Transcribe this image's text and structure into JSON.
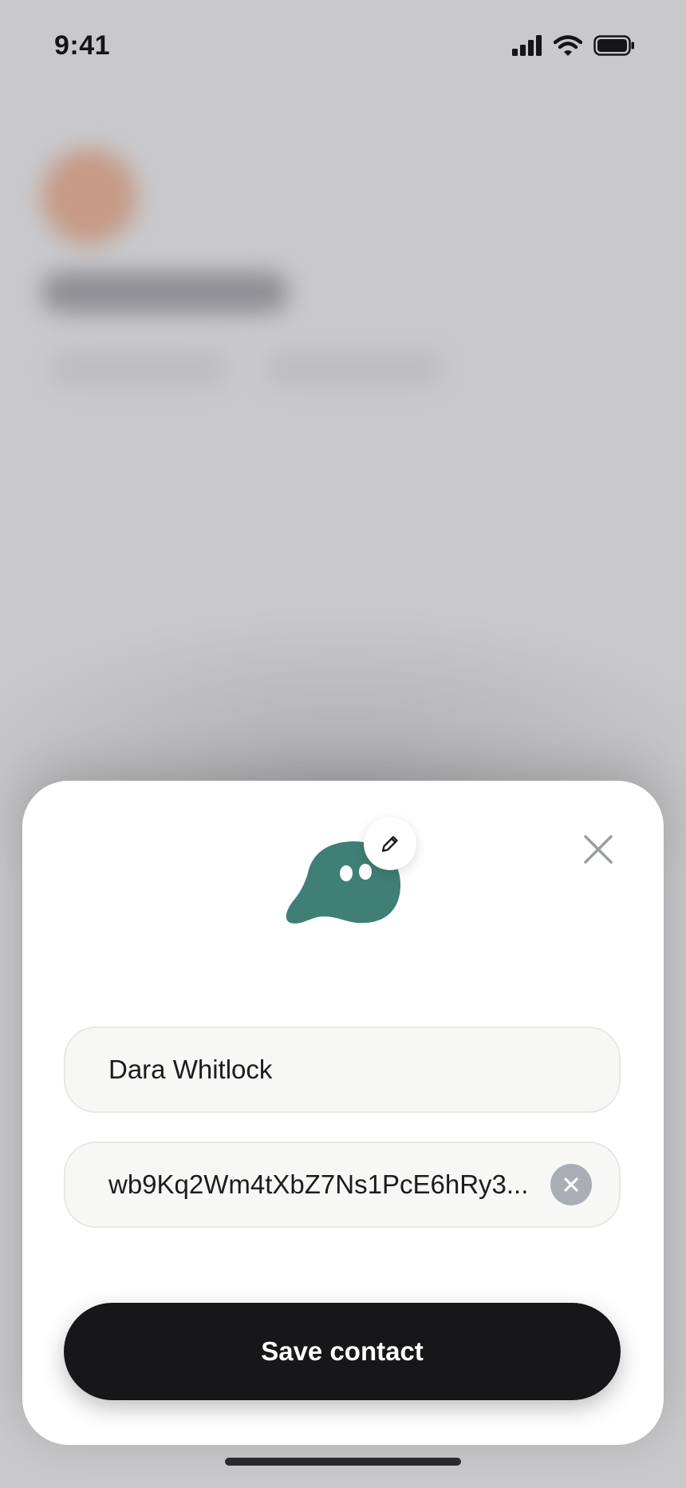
{
  "status_bar": {
    "time": "9:41",
    "signal_icon": "cellular-signal-icon",
    "wifi_icon": "wifi-icon",
    "battery_icon": "battery-icon"
  },
  "sheet": {
    "close_icon": "close-icon",
    "avatar_icon": "blob-creature-avatar",
    "edit_icon": "pencil-icon",
    "name_field": {
      "value": "Dara Whitlock"
    },
    "address_field": {
      "value": "wb9Kq2Wm4tXbZ7Ns1PcE6hRy3..."
    },
    "clear_icon": "clear-icon",
    "save_label": "Save contact"
  },
  "colors": {
    "backdrop": "#c9c9cc",
    "avatar_fill": "#3f7f75",
    "button_bg": "#17171a",
    "clear_bg": "#a9adb4"
  }
}
